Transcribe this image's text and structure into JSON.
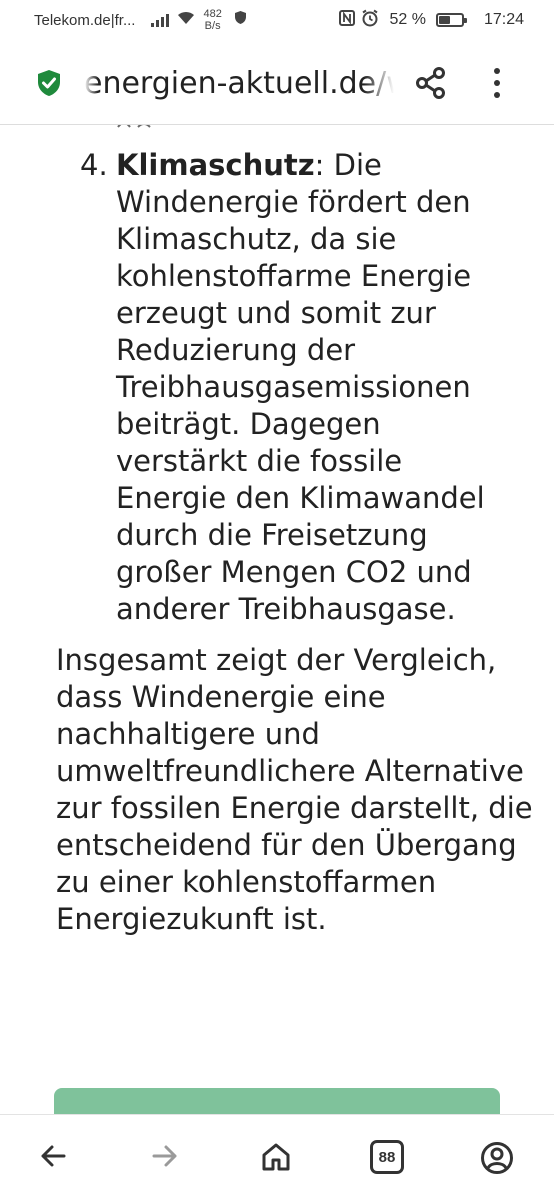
{
  "status_bar": {
    "carrier": "Telekom.de|fr...",
    "net_speed_value": "482",
    "net_speed_unit": "B/s",
    "battery_percent": "52 %",
    "battery_level": 0.52,
    "time": "17:24",
    "icons": [
      "signal-icon",
      "wifi-icon",
      "shield-icon",
      "nfc-icon",
      "alarm-icon",
      "battery-icon"
    ]
  },
  "url_bar": {
    "url_text": "energien-aktuell.de/w",
    "lock_icon": "shield-check-icon",
    "lock_color": "#1f8a3c"
  },
  "article": {
    "list_number": "4.",
    "list_heading": "Klimaschutz",
    "list_text": ": Die Windenergie fördert den Klimaschutz, da sie kohlenstoffarme Energie erzeugt und somit zur Reduzierung der Treibhausgasemissionen beiträgt. Dagegen verstärkt die fossile Energie den Klimawandel durch die Freisetzung großer Mengen CO2 und anderer Treibhausgase.",
    "summary": "Insgesamt zeigt der Vergleich, dass Windenergie eine nachhaltigere und umweltfreundlichere Alternative zur fossilen Energie darstellt, die entscheidend für den Übergang zu einer kohlenstoffarmen Energiezukunft ist.",
    "accent_color": "#7fc29b"
  },
  "bottom_nav": {
    "tab_count": "88",
    "icons": [
      "back-arrow-icon",
      "forward-arrow-icon",
      "home-icon",
      "tabs-icon",
      "profile-icon"
    ]
  }
}
